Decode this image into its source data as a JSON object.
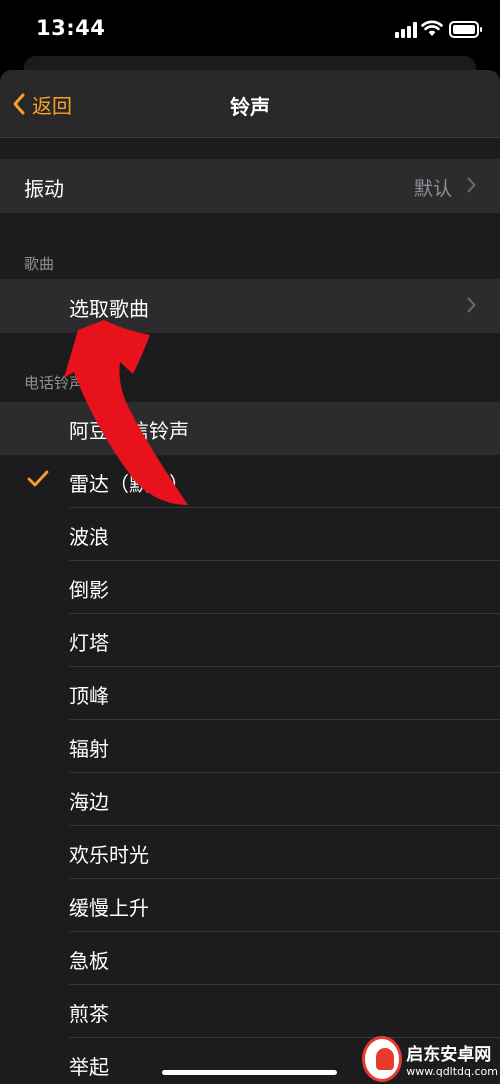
{
  "status_bar": {
    "time": "13:44"
  },
  "nav": {
    "back_label": "返回",
    "title": "铃声"
  },
  "vibration": {
    "label": "振动",
    "value": "默认"
  },
  "songs": {
    "header": "歌曲",
    "pick_label": "选取歌曲"
  },
  "ringtones": {
    "header": "电话铃声",
    "items": [
      {
        "label": "阿豆短信铃声",
        "checked": false
      },
      {
        "label": "雷达（默认）",
        "checked": true
      },
      {
        "label": "波浪",
        "checked": false
      },
      {
        "label": "倒影",
        "checked": false
      },
      {
        "label": "灯塔",
        "checked": false
      },
      {
        "label": "顶峰",
        "checked": false
      },
      {
        "label": "辐射",
        "checked": false
      },
      {
        "label": "海边",
        "checked": false
      },
      {
        "label": "欢乐时光",
        "checked": false
      },
      {
        "label": "缓慢上升",
        "checked": false
      },
      {
        "label": "急板",
        "checked": false
      },
      {
        "label": "煎茶",
        "checked": false
      },
      {
        "label": "举起",
        "checked": false
      }
    ]
  },
  "watermark": {
    "name": "启东安卓网",
    "url": "www.qdltdq.com"
  },
  "colors": {
    "accent": "#f7a227",
    "arrow": "#e8121c",
    "cell_bg": "#2c2c2e",
    "sheet_bg": "#1c1c1e"
  }
}
